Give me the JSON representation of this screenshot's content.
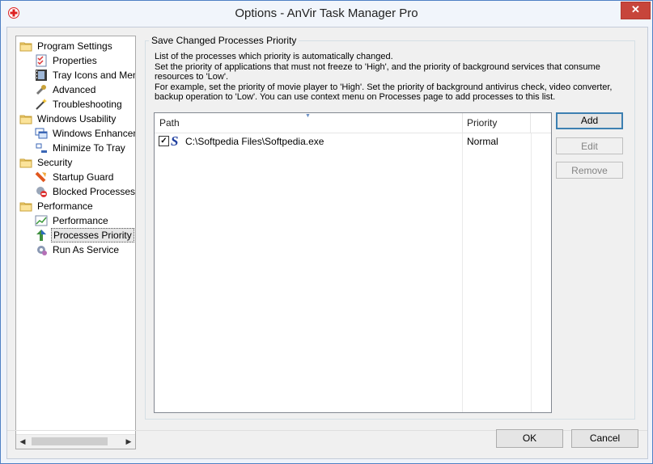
{
  "window": {
    "title": "Options - AnVir Task Manager Pro"
  },
  "colors": {
    "accent": "#3c7fb1",
    "close": "#c7453b"
  },
  "tree": {
    "items": [
      {
        "label": "Program Settings",
        "icon": "folder-icon",
        "level": 0
      },
      {
        "label": "Properties",
        "icon": "checklist-icon",
        "level": 1
      },
      {
        "label": "Tray Icons and Menu",
        "icon": "film-icon",
        "level": 1
      },
      {
        "label": "Advanced",
        "icon": "tools-icon",
        "level": 1
      },
      {
        "label": "Troubleshooting",
        "icon": "wand-icon",
        "level": 1
      },
      {
        "label": "Windows Usability",
        "icon": "folder-icon",
        "level": 0
      },
      {
        "label": "Windows Enhancements",
        "icon": "windows-icon",
        "level": 1
      },
      {
        "label": "Minimize To Tray",
        "icon": "minimize-icon",
        "level": 1
      },
      {
        "label": "Security",
        "icon": "folder-icon",
        "level": 0
      },
      {
        "label": "Startup Guard",
        "icon": "guard-icon",
        "level": 1
      },
      {
        "label": "Blocked Processes",
        "icon": "blocked-icon",
        "level": 1
      },
      {
        "label": "Performance",
        "icon": "folder-icon",
        "level": 0
      },
      {
        "label": "Performance",
        "icon": "chart-icon",
        "level": 1
      },
      {
        "label": "Processes Priority",
        "icon": "priority-icon",
        "level": 1,
        "selected": true
      },
      {
        "label": "Run As Service",
        "icon": "gear-icon",
        "level": 1
      }
    ]
  },
  "group": {
    "title": "Save Changed Processes Priority",
    "desc1": "List of the processes which priority is automatically changed.",
    "desc2": "Set the priority of applications that must not freeze to 'High', and the priority of background services that consume resources to 'Low'.",
    "desc3": "For example, set the priority of movie player to 'High'. Set the priority of background antivirus check, video converter, backup operation to 'Low'. You can use context menu on Processes page to add processes to this list."
  },
  "list": {
    "headers": {
      "path": "Path",
      "priority": "Priority"
    },
    "rows": [
      {
        "path": "C:\\Softpedia Files\\Softpedia.exe",
        "priority": "Normal",
        "checked": true
      }
    ]
  },
  "buttons": {
    "add": "Add",
    "edit": "Edit",
    "remove": "Remove",
    "ok": "OK",
    "cancel": "Cancel"
  }
}
